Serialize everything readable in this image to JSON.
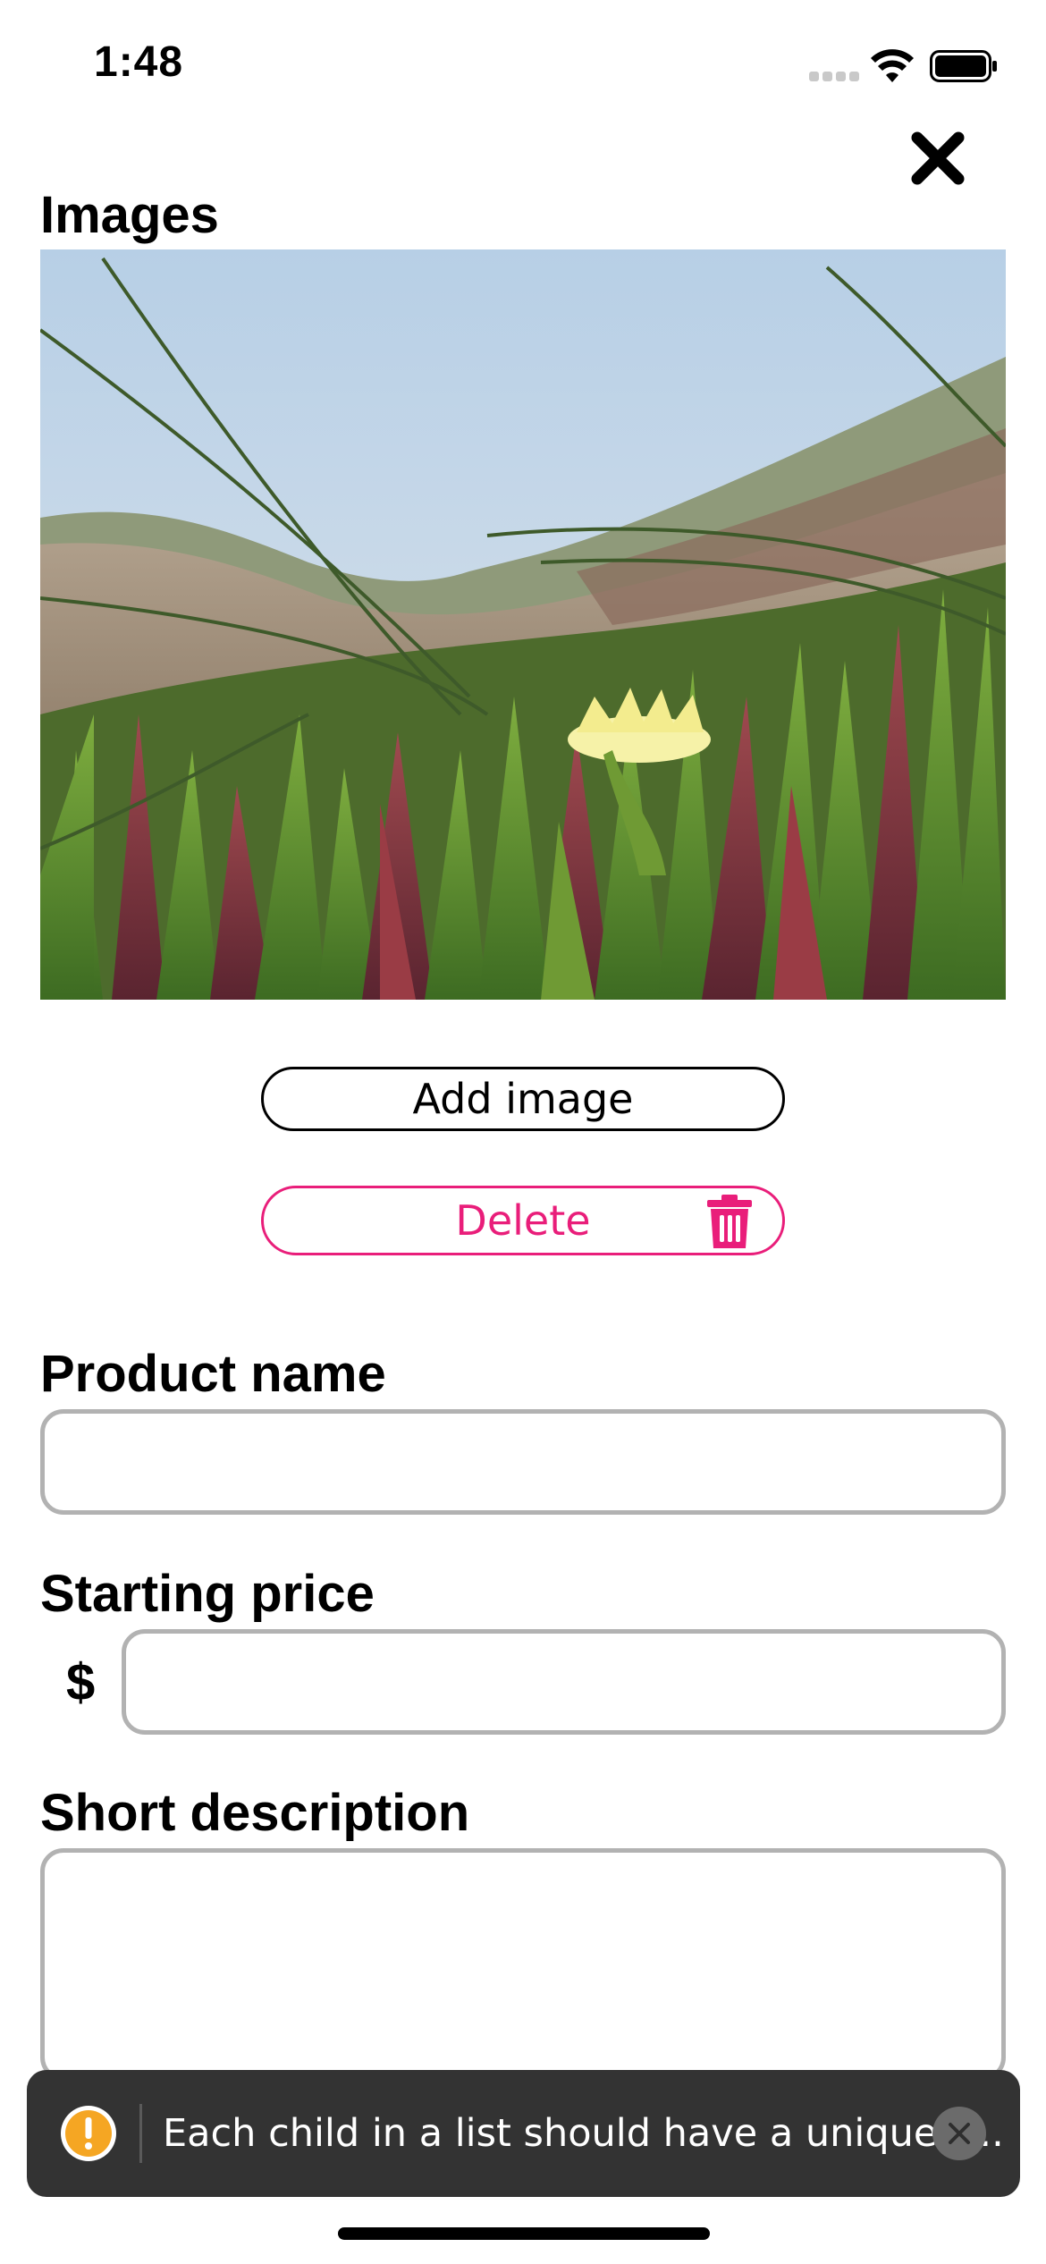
{
  "status_bar": {
    "time": "1:48"
  },
  "sections": {
    "images_title": "Images",
    "product_name_title": "Product name",
    "starting_price_title": "Starting price",
    "short_description_title": "Short description"
  },
  "buttons": {
    "add_image": "Add image",
    "delete": "Delete"
  },
  "inputs": {
    "product_name_value": "",
    "starting_price_value": "",
    "short_description_value": "",
    "currency_symbol": "$"
  },
  "toast": {
    "message": "Each child in a list should have a unique \"..."
  },
  "icons": {
    "close": "close-icon",
    "trash": "trash-icon",
    "warning": "warning-icon",
    "toast_close": "close-circle-icon"
  },
  "colors": {
    "accent": "#e91e7a",
    "input_border": "#b2b2b2",
    "toast_bg": "#333333",
    "warning": "#f5a623"
  }
}
